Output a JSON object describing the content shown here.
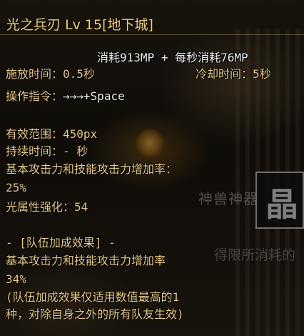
{
  "skill": {
    "name": "光之兵刃",
    "level": "Lv 15",
    "location": "[地下城]"
  },
  "cost": {
    "mp_cost": "消耗913MP",
    "plus": "+",
    "mp_per_second": "每秒消耗76MP"
  },
  "timing": {
    "cast_time": "施放时间：0.5秒",
    "cooldown": "冷却时间：5秒"
  },
  "command": {
    "label": "操作指令：",
    "sequence": "→→→+Space"
  },
  "stats": {
    "range": "有效范围：450px",
    "duration": "持续时间：- 秒",
    "attack_increase_label": "基本攻击力和技能攻击力增加率：",
    "attack_increase_value": "25%",
    "light_enhance": "光属性强化：54"
  },
  "party": {
    "header": "- [队伍加成效果] -",
    "attack_increase_label": "基本攻击力和技能攻击力增加率",
    "attack_increase_value": "34%",
    "note_line1": "(队伍加成效果仅适用数值最高的1",
    "note_line2": "种，对除自身之外的所有队友生效)"
  },
  "background": {
    "watermark_1": "神兽神器",
    "watermark_2": "得限所消耗的",
    "brand_glyph": "晶"
  }
}
